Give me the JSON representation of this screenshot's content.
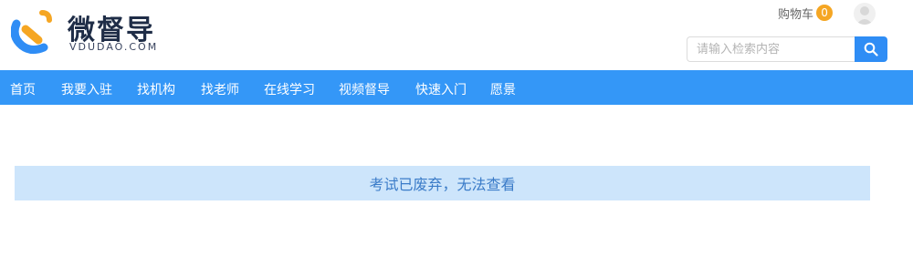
{
  "logo": {
    "name": "微督导",
    "subtitle": "VDUDAO.COM"
  },
  "header": {
    "cart_label": "购物车",
    "cart_count": "0"
  },
  "search": {
    "placeholder": "请输入检索内容"
  },
  "nav": {
    "items": [
      "首页",
      "我要入驻",
      "找机构",
      "找老师",
      "在线学习",
      "视频督导",
      "快速入门",
      "愿景"
    ]
  },
  "main": {
    "notice": "考试已废弃，无法查看"
  },
  "colors": {
    "nav_bg": "#3497f7",
    "search_button": "#2f8df5",
    "badge": "#f5a623",
    "notice_bg": "#cde5fb",
    "notice_text": "#3a7bc8"
  }
}
